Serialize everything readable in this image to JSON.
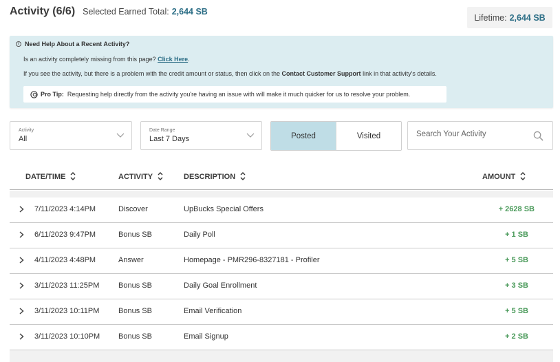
{
  "header": {
    "title": "Activity (6/6)",
    "earned_label": "Selected Earned Total:",
    "earned_value": "2,644 SB",
    "lifetime_label": "Lifetime:",
    "lifetime_value": "2,644 SB"
  },
  "help": {
    "title": "Need Help About a Recent Activity?",
    "line1_text": "Is an activity completely missing from this page?",
    "line1_link": "Click Here",
    "line1_end": ".",
    "line2_pre": "If you see the activity, but there is a problem with the credit amount or status, then click on the",
    "line2_bold": "Contact Customer Support",
    "line2_post": "link in that activity's details.",
    "pro_tip_label": "Pro Tip:",
    "pro_tip_text": "Requesting help directly from the activity you're having an issue with will make it much quicker for us to resolve your problem."
  },
  "filters": {
    "activity_label": "Activity",
    "activity_value": "All",
    "date_label": "Date Range",
    "date_value": "Last 7 Days",
    "toggle_posted": "Posted",
    "toggle_visited": "Visited",
    "search_placeholder": "Search Your Activity"
  },
  "table": {
    "columns": [
      "DATE/TIME",
      "ACTIVITY",
      "DESCRIPTION",
      "AMOUNT"
    ],
    "rows": [
      {
        "datetime": "7/11/2023 4:14PM",
        "activity": "Discover",
        "description": "UpBucks Special Offers",
        "amount": "+ 2628 SB"
      },
      {
        "datetime": "6/11/2023 9:47PM",
        "activity": "Bonus SB",
        "description": "Daily Poll",
        "amount": "+ 1 SB"
      },
      {
        "datetime": "4/11/2023 4:48PM",
        "activity": "Answer",
        "description": "Homepage - PMR296-8327181 - Profiler",
        "amount": "+ 5 SB"
      },
      {
        "datetime": "3/11/2023 11:25PM",
        "activity": "Bonus SB",
        "description": "Daily Goal Enrollment",
        "amount": "+ 3 SB"
      },
      {
        "datetime": "3/11/2023 10:11PM",
        "activity": "Bonus SB",
        "description": "Email Verification",
        "amount": "+ 5 SB"
      },
      {
        "datetime": "3/11/2023 10:10PM",
        "activity": "Bonus SB",
        "description": "Email Signup",
        "amount": "+ 2 SB"
      }
    ]
  },
  "colors": {
    "accent_teal": "#2e6f87",
    "help_bg": "#dcedf1",
    "posted_active_bg": "#bfdde6",
    "amount_green": "#4a9a5a"
  },
  "icons": [
    "info-icon",
    "tip-icon",
    "chevron-down-icon",
    "search-icon",
    "sort-icon",
    "chevron-right-icon"
  ]
}
